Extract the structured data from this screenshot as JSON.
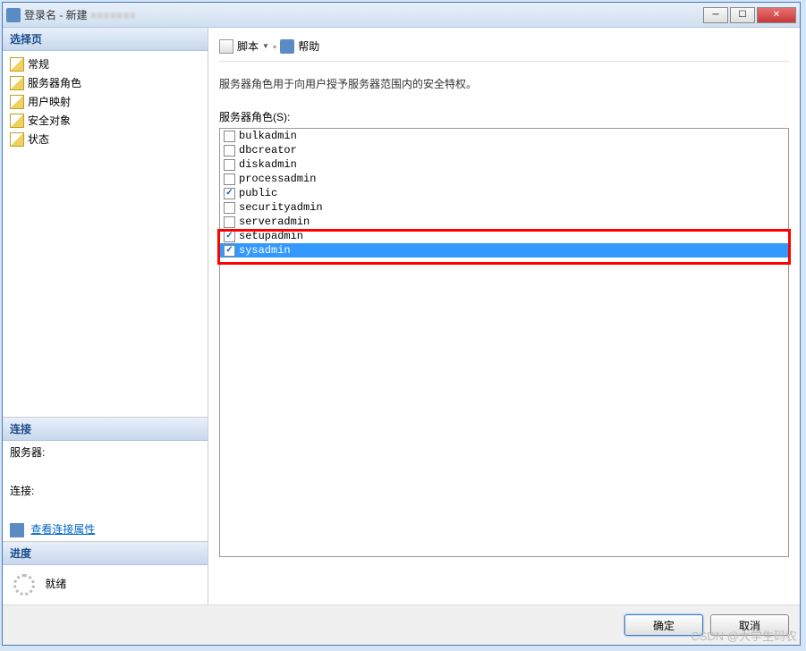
{
  "window": {
    "title": "登录名 - 新建",
    "obscured": "■■■■■■■"
  },
  "nav": {
    "header": "选择页",
    "items": [
      {
        "label": "常规"
      },
      {
        "label": "服务器角色"
      },
      {
        "label": "用户映射"
      },
      {
        "label": "安全对象"
      },
      {
        "label": "状态"
      }
    ]
  },
  "connection": {
    "header": "连接",
    "server_label": "服务器:",
    "server_value": "",
    "conn_label": "连接:",
    "conn_value": "",
    "view_props": "查看连接属性"
  },
  "progress": {
    "header": "进度",
    "status": "就绪"
  },
  "toolbar": {
    "script": "脚本",
    "help": "帮助"
  },
  "main": {
    "description": "服务器角色用于向用户授予服务器范围内的安全特权。",
    "roles_label": "服务器角色(S):",
    "roles": [
      {
        "name": "bulkadmin",
        "checked": false,
        "selected": false
      },
      {
        "name": "dbcreator",
        "checked": false,
        "selected": false
      },
      {
        "name": "diskadmin",
        "checked": false,
        "selected": false
      },
      {
        "name": "processadmin",
        "checked": false,
        "selected": false
      },
      {
        "name": "public",
        "checked": true,
        "selected": false
      },
      {
        "name": "securityadmin",
        "checked": false,
        "selected": false
      },
      {
        "name": "serveradmin",
        "checked": false,
        "selected": false
      },
      {
        "name": "setupadmin",
        "checked": true,
        "selected": false
      },
      {
        "name": "sysadmin",
        "checked": true,
        "selected": true
      }
    ]
  },
  "buttons": {
    "ok": "确定",
    "cancel": "取消"
  },
  "watermark": "CSDN @大学生码农"
}
